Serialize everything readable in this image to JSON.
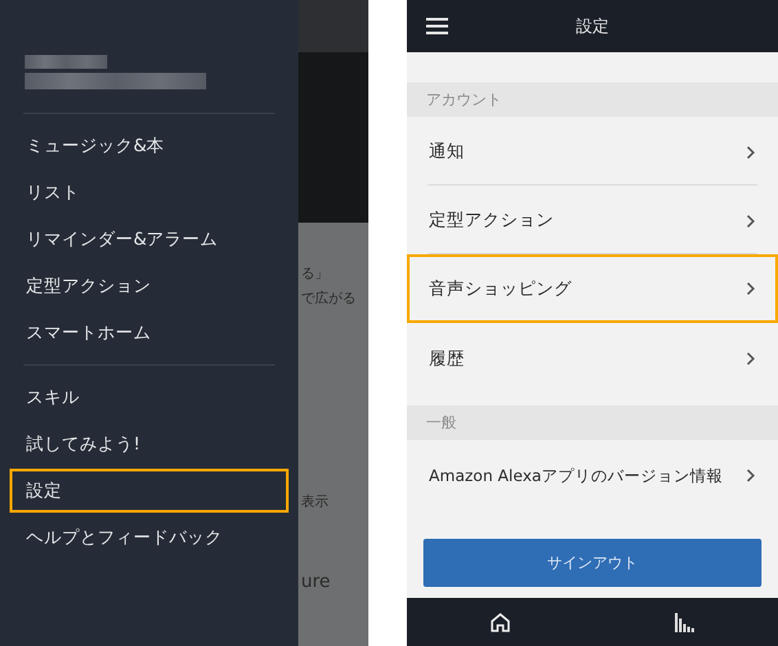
{
  "left_screen": {
    "drawer": {
      "account_hidden": true,
      "groups": [
        {
          "items": [
            {
              "label": "ミュージック&本",
              "highlighted": false
            },
            {
              "label": "リスト",
              "highlighted": false
            },
            {
              "label": "リマインダー&アラーム",
              "highlighted": false
            },
            {
              "label": "定型アクション",
              "highlighted": false
            },
            {
              "label": "スマートホーム",
              "highlighted": false
            }
          ]
        },
        {
          "items": [
            {
              "label": "スキル",
              "highlighted": false
            },
            {
              "label": "試してみよう!",
              "highlighted": false
            },
            {
              "label": "設定",
              "highlighted": true
            },
            {
              "label": "ヘルプとフィードバック",
              "highlighted": false
            }
          ]
        }
      ]
    },
    "background_texts": [
      "る」",
      "で広がる",
      "表示",
      "ure"
    ]
  },
  "right_screen": {
    "title": "設定",
    "sections": [
      {
        "heading": "アカウント",
        "rows": [
          {
            "label": "通知",
            "highlighted": false
          },
          {
            "label": "定型アクション",
            "highlighted": false
          },
          {
            "label": "音声ショッピング",
            "highlighted": true
          },
          {
            "label": "履歴",
            "highlighted": false
          }
        ]
      },
      {
        "heading": "一般",
        "rows": [
          {
            "label": "Amazon Alexaアプリのバージョン情報",
            "highlighted": false
          }
        ]
      }
    ],
    "sign_out_button": "サインアウト"
  }
}
